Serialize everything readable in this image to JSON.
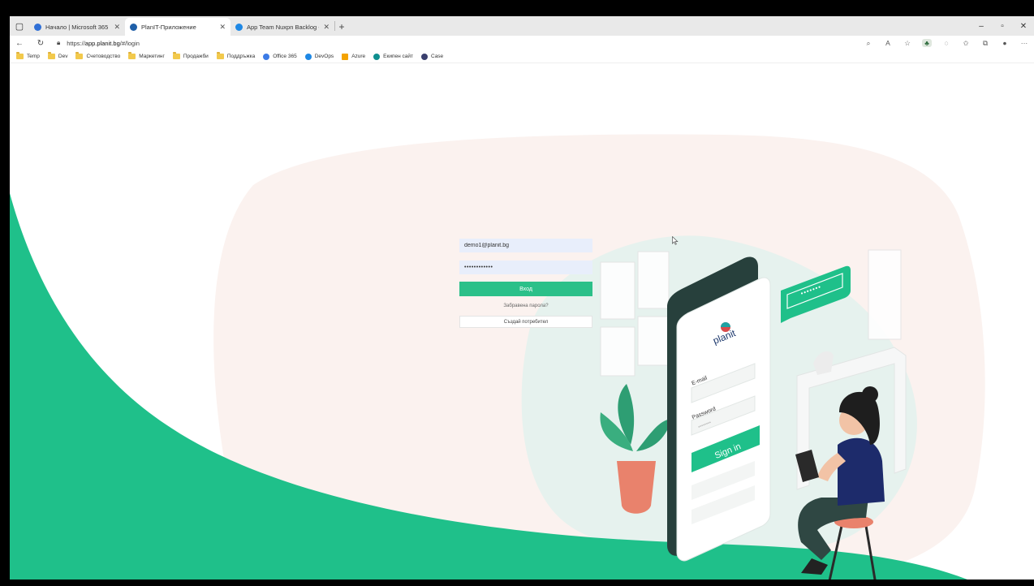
{
  "browser": {
    "tabs": [
      {
        "title": "Начало | Microsoft 365",
        "favicon_color": "#2f6fd6",
        "active": false
      },
      {
        "title": "PlanIT-Приложение",
        "favicon_color": "#1f5fa8",
        "active": true
      },
      {
        "title": "App Team Nuxpn Backlog - Bo...",
        "favicon_color": "#1e88e5",
        "active": false
      }
    ],
    "address": {
      "prefix": "https://",
      "host": "app.planit.bg",
      "path": "/#/login"
    },
    "bookmarks": [
      {
        "label": "Temp",
        "kind": "folder"
      },
      {
        "label": "Dev",
        "kind": "folder"
      },
      {
        "label": "Счетоводство",
        "kind": "folder"
      },
      {
        "label": "Маркетинг",
        "kind": "folder"
      },
      {
        "label": "Продажби",
        "kind": "folder"
      },
      {
        "label": "Поддръжка",
        "kind": "folder"
      },
      {
        "label": "Office 365",
        "kind": "link",
        "color": "#3c7be6"
      },
      {
        "label": "DevOps",
        "kind": "link",
        "color": "#1e88e5"
      },
      {
        "label": "Azure",
        "kind": "link",
        "color": "#f4a300"
      },
      {
        "label": "Екипен сайт",
        "kind": "link",
        "color": "#0f8f8f"
      },
      {
        "label": "Case",
        "kind": "link",
        "color": "#3a3f6e"
      }
    ]
  },
  "login": {
    "email_value": "demo1@planit.bg",
    "password_value": "••••••••••••",
    "login_label": "Вход",
    "forgot_label": "Забравена парола?",
    "register_label": "Създай потребител"
  },
  "illustration": {
    "phone_email_label": "E-mail",
    "phone_password_label": "Password",
    "phone_sign_in_label": "Sign in",
    "phone_logo_text": "planit",
    "phone_password_dots": "••••••••",
    "bubble_password_dots": "•••••••"
  },
  "colors": {
    "brand_green": "#2bc089",
    "field_bg": "#e8eefb",
    "blob_pink": "#fbf2ef",
    "blob_mint": "#e6f2ee"
  }
}
